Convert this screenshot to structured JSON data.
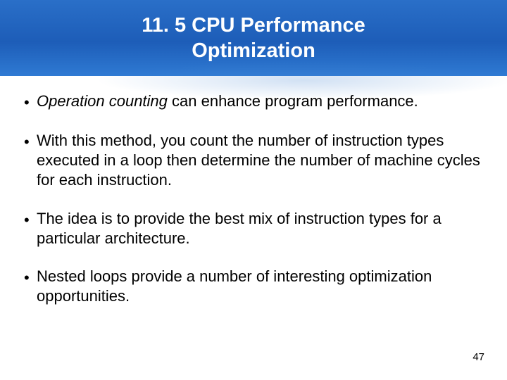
{
  "slide": {
    "title_line1": "11. 5 CPU Performance",
    "title_line2": "Optimization",
    "bullets": [
      {
        "prefix_italic": "Operation counting",
        "rest": " can enhance program performance."
      },
      {
        "prefix_italic": "",
        "rest": "With this method, you count the number of instruction types executed in a loop then determine the number of machine cycles for each instruction."
      },
      {
        "prefix_italic": "",
        "rest": "The idea is to provide the best mix of instruction types for a particular architecture."
      },
      {
        "prefix_italic": "",
        "rest": "Nested loops provide a number of interesting optimization opportunities."
      }
    ],
    "page_number": "47"
  }
}
